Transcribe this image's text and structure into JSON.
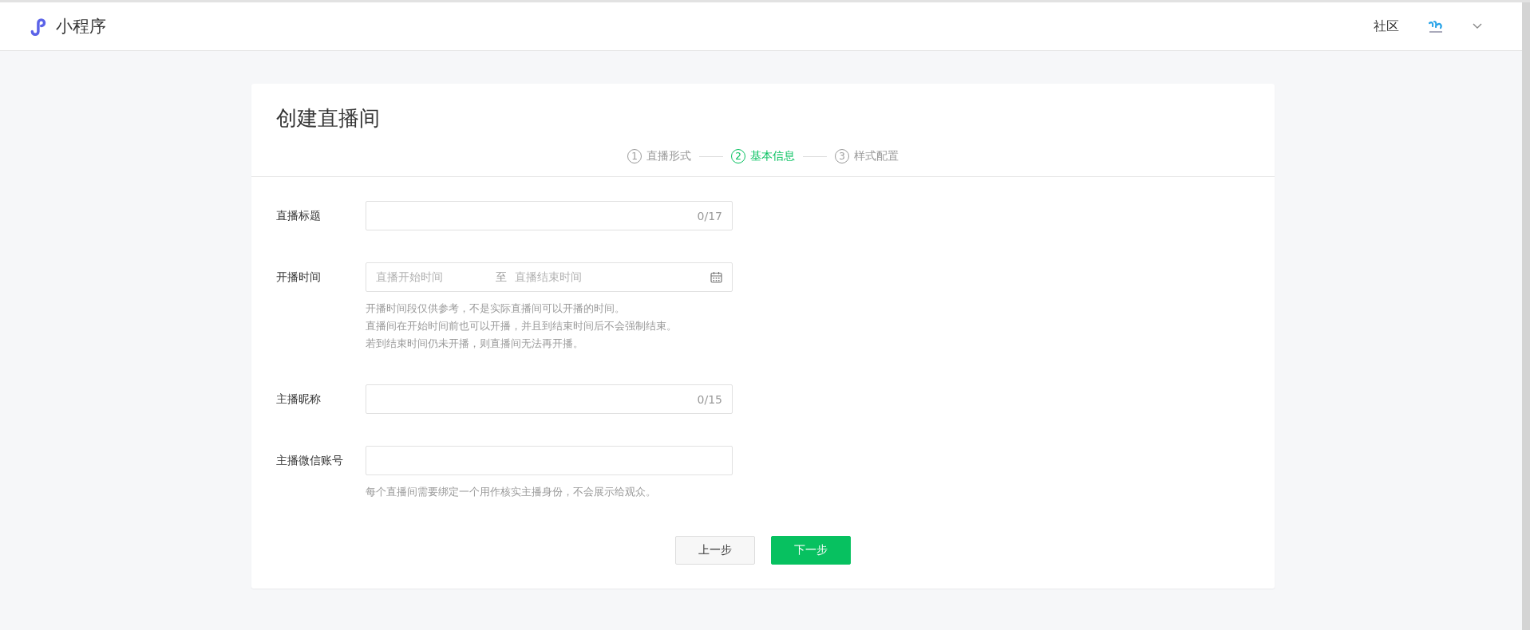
{
  "header": {
    "app_name": "小程序",
    "nav_link": "社区"
  },
  "page": {
    "title": "创建直播间",
    "steps": [
      {
        "number": "1",
        "label": "直播形式",
        "selected": false
      },
      {
        "number": "2",
        "label": "基本信息",
        "selected": true
      },
      {
        "number": "3",
        "label": "样式配置",
        "selected": false
      }
    ]
  },
  "form": {
    "fields": [
      {
        "kind": "text",
        "label": "直播标题",
        "counter": "0/17"
      },
      {
        "kind": "date_range",
        "label": "开播时间",
        "start_placeholder": "直播开始时间",
        "separator": "至",
        "end_placeholder": "直播结束时间",
        "help": [
          "开播时间段仅供参考，不是实际直播间可以开播的时间。",
          "直播间在开始时间前也可以开播，并且到结束时间后不会强制结束。",
          "若到结束时间仍未开播，则直播间无法再开播。"
        ]
      },
      {
        "kind": "text",
        "label": "主播昵称",
        "counter": "0/15"
      },
      {
        "kind": "text",
        "label": "主播微信账号",
        "help": [
          "每个直播间需要绑定一个用作核实主播身份，不会展示给观众。"
        ]
      }
    ],
    "buttons": [
      {
        "kind": "secondary",
        "label": "上一步"
      },
      {
        "kind": "primary",
        "label": "下一步"
      }
    ]
  }
}
